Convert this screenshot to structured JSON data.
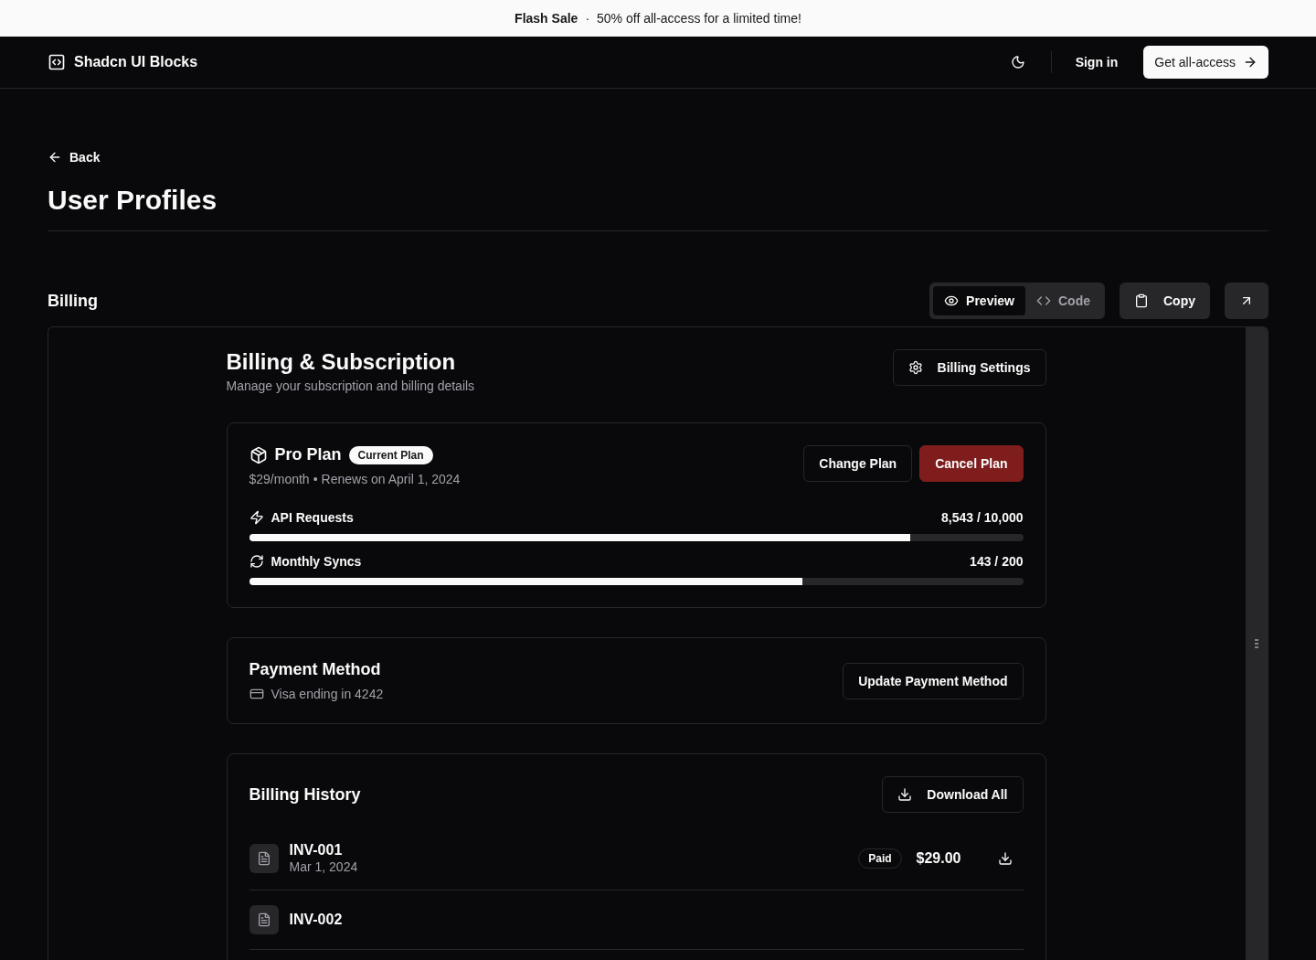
{
  "banner": {
    "title": "Flash Sale",
    "separator": "·",
    "message": "50% off all-access for a limited time!"
  },
  "header": {
    "brand": "Shadcn UI Blocks",
    "sign_in": "Sign in",
    "cta": "Get all-access"
  },
  "page": {
    "back": "Back",
    "title": "User Profiles"
  },
  "block": {
    "title": "Billing",
    "view_tabs": [
      {
        "label": "Preview",
        "kind": "preview",
        "selected": true
      },
      {
        "label": "Code",
        "kind": "code",
        "selected": false
      }
    ],
    "copy": "Copy"
  },
  "billing": {
    "title": "Billing & Subscription",
    "subtitle": "Manage your subscription and billing details",
    "settings_button": "Billing Settings",
    "plan": {
      "name": "Pro Plan",
      "badge": "Current Plan",
      "price": "$29/month",
      "bullet": "•",
      "renews": "Renews on April 1, 2024",
      "change": "Change Plan",
      "cancel": "Cancel Plan",
      "usage": [
        {
          "kind": "api",
          "label": "API Requests",
          "reading": "8,543 / 10,000",
          "level": 0.8543
        },
        {
          "kind": "sync",
          "label": "Monthly Syncs",
          "reading": "143 / 200",
          "level": 0.715
        }
      ]
    },
    "payment": {
      "title": "Payment Method",
      "card": "Visa ending in 4242",
      "button": "Update Payment Method"
    },
    "history": {
      "title": "Billing History",
      "button": "Download All",
      "invoices": [
        {
          "id": "INV-001",
          "date": "Mar 1, 2024",
          "status": "Paid",
          "amount": "$29.00"
        },
        {
          "id": "INV-002"
        }
      ]
    }
  }
}
